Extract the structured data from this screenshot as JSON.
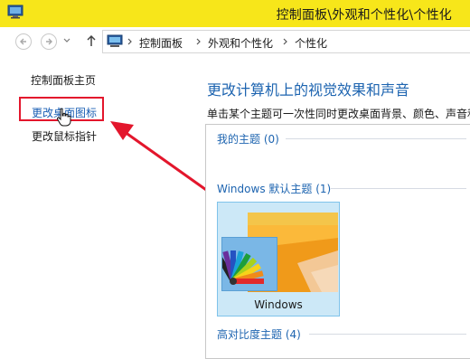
{
  "window": {
    "title": "控制面板\\外观和个性化\\个性化"
  },
  "address_bar": {
    "breadcrumbs": [
      "控制面板",
      "外观和个性化",
      "个性化"
    ]
  },
  "left_pane": {
    "home_link": "控制面板主页",
    "links": [
      "更改桌面图标",
      "更改鼠标指针"
    ]
  },
  "main": {
    "heading": "更改计算机上的视觉效果和声音",
    "subheading": "单击某个主题可一次性同时更改桌面背景、颜色、声音和",
    "groups": [
      {
        "title": "我的主题 (0)"
      },
      {
        "title": "Windows 默认主题 (1)"
      },
      {
        "title": "高对比度主题 (4)"
      }
    ],
    "themes": [
      {
        "name": "Windows",
        "selected": true
      }
    ]
  },
  "colors": {
    "titlebar": "#f7e61a",
    "link_blue": "#1d64b0",
    "highlight_red": "#e3162c",
    "tile_selected": "#cce8f7"
  }
}
